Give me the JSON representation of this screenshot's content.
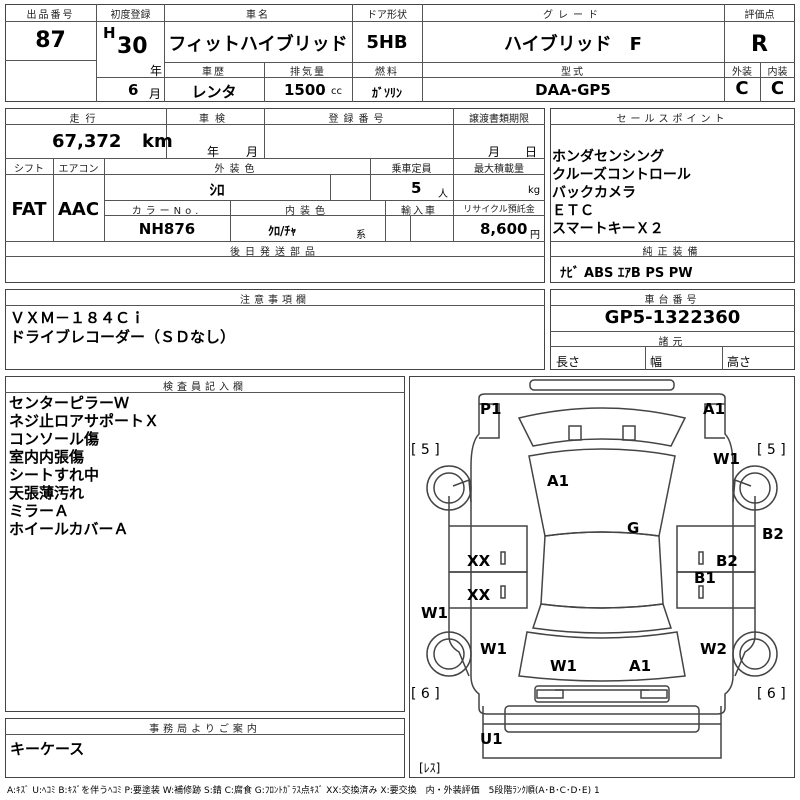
{
  "header": {
    "lot_label": "出品番号",
    "lot_no": "87",
    "first_reg_label": "初度登録",
    "era": "H",
    "year": "30",
    "year_unit": "年",
    "month": "6",
    "month_unit": "月",
    "car_name_label": "車名",
    "car_name": "フィットハイブリッド",
    "door_label": "ドア形状",
    "door": "5HB",
    "grade_label": "グレード",
    "grade": "ハイブリッド　F",
    "score_label": "評価点",
    "score": "R",
    "history_label": "車歴",
    "history": "レンタ",
    "displacement_label": "排気量",
    "displacement": "1500",
    "displacement_unit": "cc",
    "fuel_label": "燃料",
    "fuel": "ｶﾞｿﾘﾝ",
    "model_label": "型式",
    "model": "DAA-GP5",
    "ext_label": "外装",
    "ext_grade": "C",
    "int_label": "内装",
    "int_grade": "C"
  },
  "details": {
    "mileage_label": "走行",
    "mileage": "67,372",
    "mileage_unit": "km",
    "inspection_label": "車検",
    "inspection_year": "年",
    "inspection_month": "月",
    "reg_no_label": "登録番号",
    "transfer_label": "譲渡書類期限",
    "transfer_month": "月",
    "transfer_day": "日",
    "shift_label": "シフト",
    "shift": "FAT",
    "ac_label": "エアコン",
    "ac": "AAC",
    "ext_color_label": "外装色",
    "ext_color": "ｼﾛ",
    "capacity_label": "乗車定員",
    "capacity": "5",
    "capacity_unit": "人",
    "load_label": "最大積載量",
    "load_unit": "kg",
    "color_no_label": "カラーNo.",
    "color_no": "NH876",
    "int_color_label": "内装色",
    "int_color": "ｸﾛ/ﾁｬ",
    "int_color_suffix": "系",
    "import_label": "輸入車",
    "recycle_label": "リサイクル預託金",
    "recycle": "8,600",
    "recycle_unit": "円",
    "later_parts_label": "後日発送部品"
  },
  "sales_points": {
    "label": "セールスポイント",
    "items": [
      "ホンダセンシング",
      "クルーズコントロール",
      "バックカメラ",
      "ＥＴＣ",
      "スマートキーＸ２"
    ]
  },
  "equipment": {
    "label": "純正装備",
    "value": "ﾅﾋﾞ ABS ｴｱB PS PW"
  },
  "notes": {
    "label": "注意事項欄",
    "lines": [
      "ＶＸＭ－１８４Ｃｉ",
      "ドライブレコーダー（ＳＤなし）"
    ]
  },
  "chassis": {
    "label": "車台番号",
    "value": "GP5-1322360",
    "dims_label": "諸元",
    "length_label": "長さ",
    "width_label": "幅",
    "height_label": "高さ"
  },
  "inspector": {
    "label": "検査員記入欄",
    "lines": [
      "センターピラーＷ",
      "ネジ止ロアサポートＸ",
      "コンソール傷",
      "室内内張傷",
      "シートすれ中",
      "天張薄汚れ",
      "ミラーＡ",
      "ホイールカバーＡ"
    ]
  },
  "office": {
    "label": "事務局よりご案内",
    "value": "キーケース"
  },
  "diagram": {
    "marks": {
      "p1": "P1",
      "a1_fr": "A1",
      "w1_fr": "W1",
      "a1_hood": "A1",
      "g": "G",
      "b2_side": "B2",
      "xx_lf": "XX",
      "xx_lr": "XX",
      "b2": "B2",
      "b1": "B1",
      "w1_left": "W1",
      "w1_lr": "W1",
      "w1_rear": "W1",
      "a1_rear": "A1",
      "w2_rr": "W2",
      "u1": "U1",
      "five_left": "[ 5 ]",
      "five_right": "[ 5 ]",
      "six_left": "[ 6 ]",
      "six_right": "[ 6 ]",
      "les": "[ﾚｽ]"
    }
  },
  "legend": "A:ｷｽﾞ U:ﾍｺﾐ B:ｷｽﾞを伴うﾍｺﾐ P:要塗装 W:補修跡 S:錆 C:腐食 G:ﾌﾛﾝﾄｶﾞﾗｽ点ｷｽﾞ XX:交換済み X:要交換　内・外装評価　5段階ﾗﾝｸ順(A･B･C･D･E) 1",
  "colors": {
    "line": "#444444",
    "text": "#000000"
  }
}
